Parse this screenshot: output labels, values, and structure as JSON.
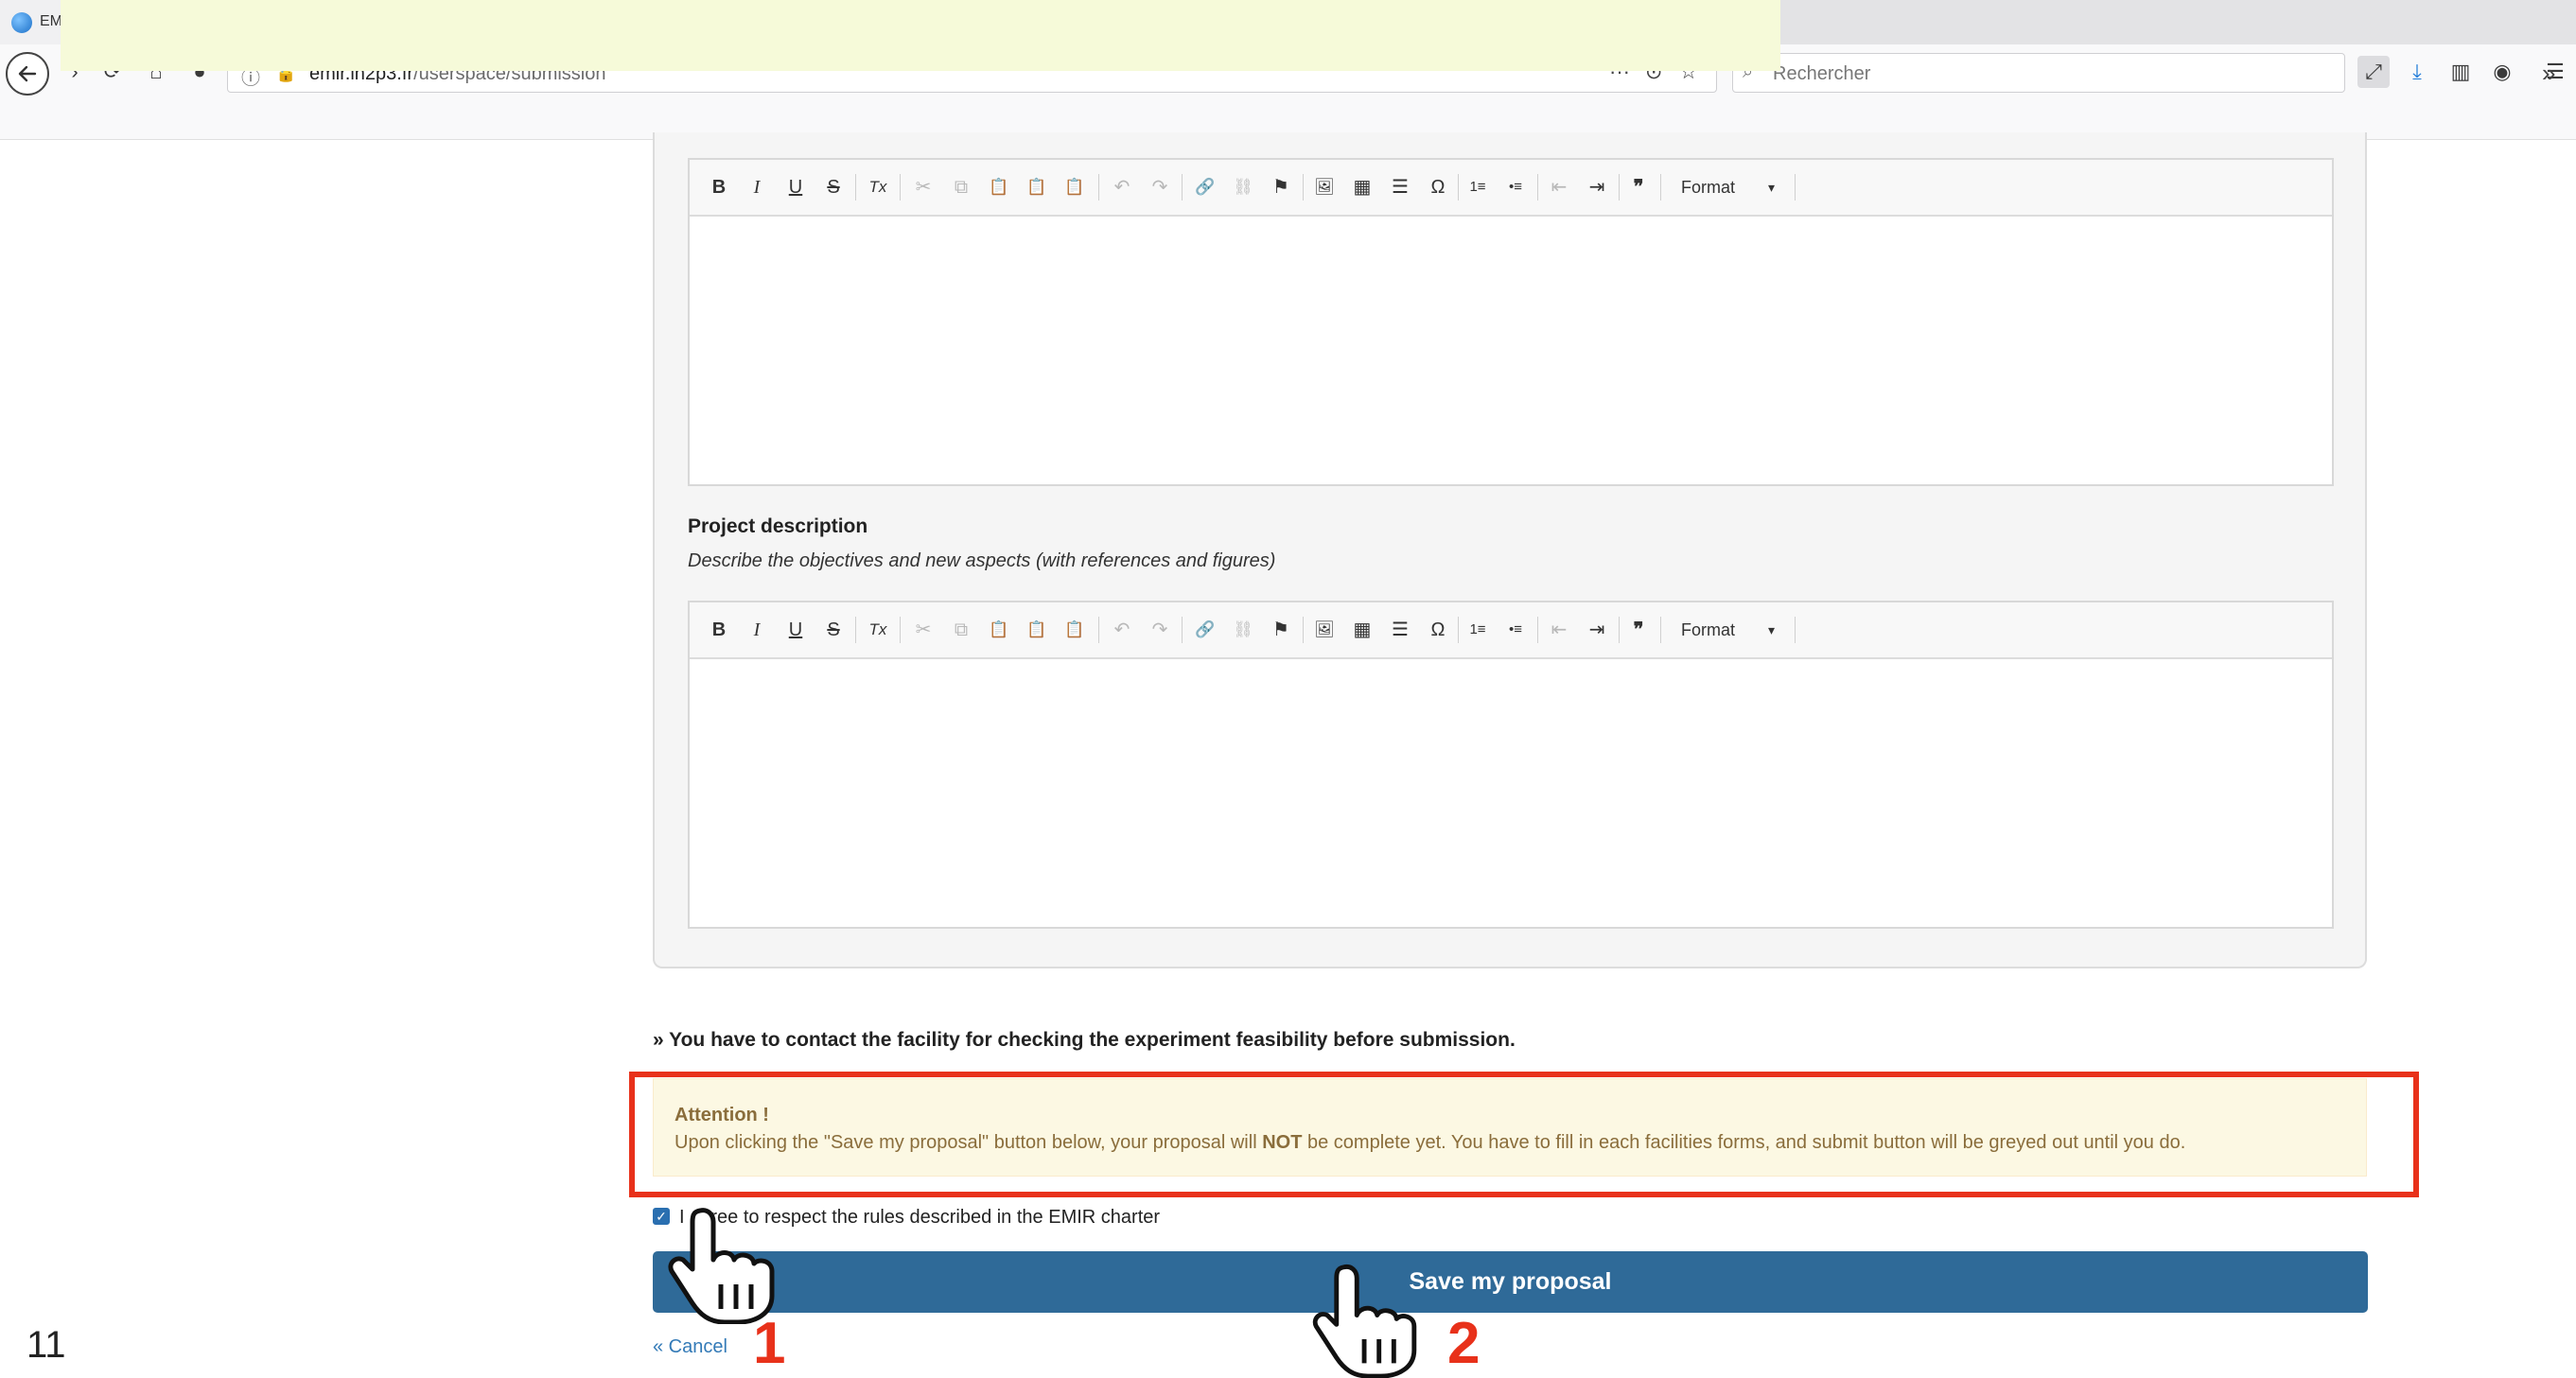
{
  "browser": {
    "tab_title": "EM",
    "url_domain": "emir.in2p3.fr",
    "url_path": "/userspace/submission",
    "search_placeholder": "Rechercher"
  },
  "editor_toolbar": {
    "buttons": [
      "B",
      "I",
      "U",
      "S",
      "Tx",
      "✂",
      "⧉",
      "📋",
      "📋",
      "📋",
      "↶",
      "↷",
      "🔗",
      "⛓",
      "⚑",
      "🖼",
      "▦",
      "☰",
      "Ω",
      "1≡",
      "•≡",
      "⇤",
      "⇥",
      "❞"
    ],
    "format_label": "Format"
  },
  "project_description": {
    "label": "Project description",
    "help": "Describe the objectives and new aspects (with references and figures)"
  },
  "notice": "» You have to contact the facility for checking the experiment feasibility before submission.",
  "alert": {
    "title": "Attention !",
    "body_part1": "Upon clicking the \"Save my proposal\" button below, your proposal will ",
    "body_strong": "NOT",
    "body_part2": " be complete yet. You have to fill in each facilities forms, and submit button will be greyed out until you do."
  },
  "agree": {
    "checked": true,
    "label": "I agree to respect the rules described in the EMIR charter"
  },
  "save_button": "Save my proposal",
  "cancel_link": "« Cancel",
  "page_number": "11",
  "annotations": {
    "step1": "1",
    "step2": "2",
    "highlight_color": "#e8311a"
  }
}
